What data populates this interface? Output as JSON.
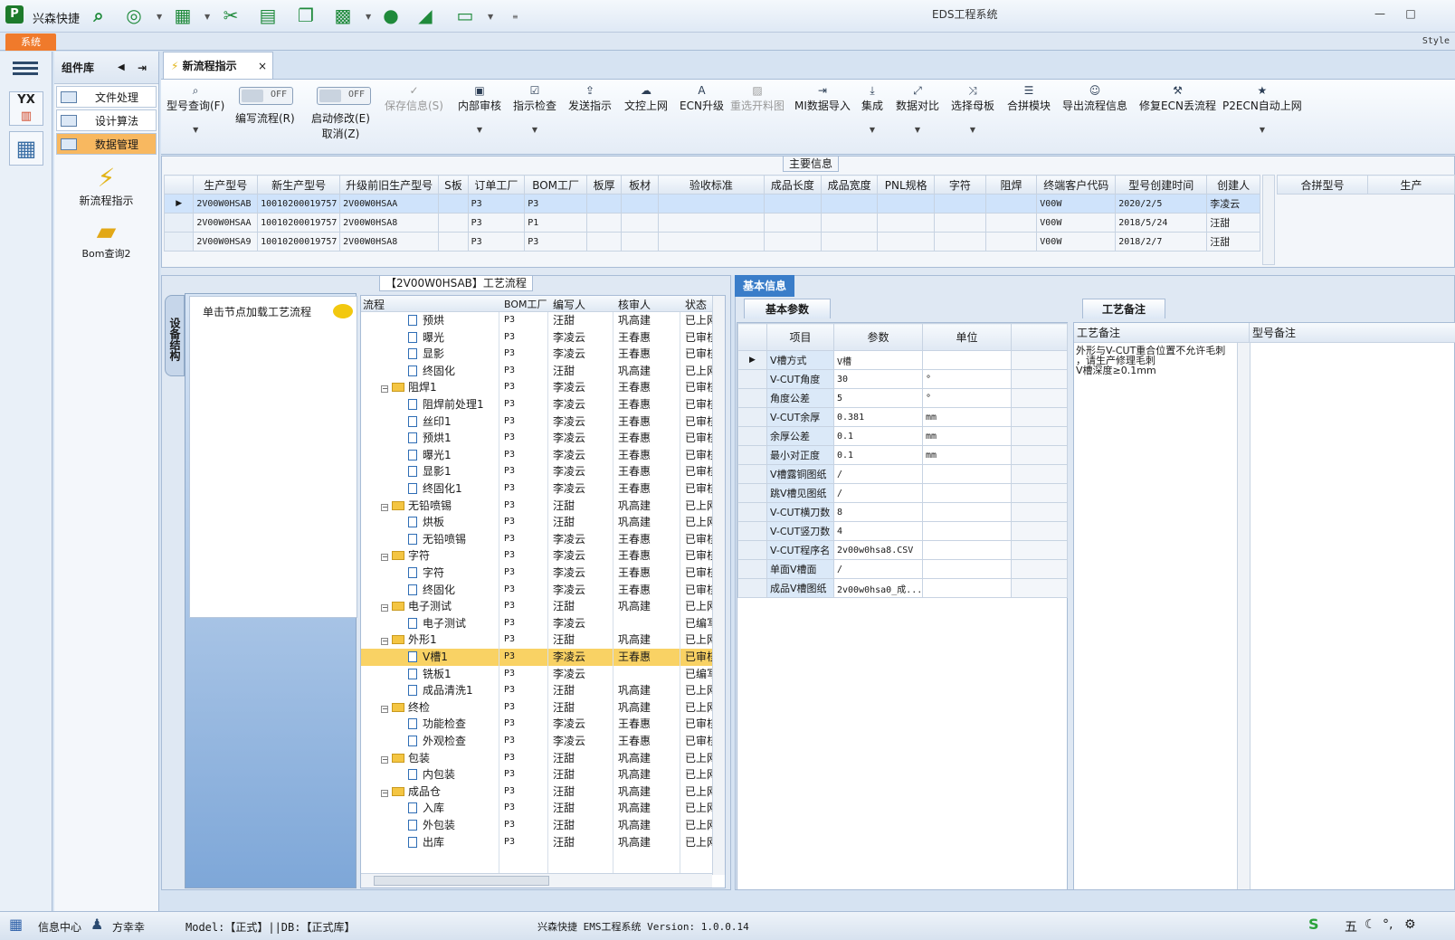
{
  "app": {
    "name": "兴森快捷",
    "window_title": "EDS工程系统",
    "system_tab": "系统",
    "style_label": "Style"
  },
  "quickbar_icons": [
    "search-icon",
    "lifebuoy-icon",
    "grid-icon",
    "scissors-icon",
    "film-icon",
    "copy-icon",
    "apps-icon",
    "user-icon",
    "chart-icon",
    "monitor-icon"
  ],
  "component_library": {
    "title": "组件库",
    "items": [
      {
        "label": "文件处理"
      },
      {
        "label": "设计算法"
      },
      {
        "label": "数据管理"
      }
    ],
    "launchers": [
      {
        "label": "新流程指示"
      },
      {
        "label": "Bom查询2"
      }
    ]
  },
  "main_tab": {
    "label": "新流程指示",
    "close": "×"
  },
  "toolbar": {
    "query": "型号查询(F)",
    "edit_flow": "编写流程(R)",
    "start_modify": "启动修改(E)",
    "cancel": "取消(Z)",
    "toggle_off": "OFF",
    "save": "保存信息(S)",
    "internal_review": "内部审核",
    "check": "指示检查",
    "send": "发送指示",
    "upload": "文控上网",
    "ecn_upgrade": "ECN升级",
    "reselect": "重选开料图",
    "mi_import": "MI数据导入",
    "integrate": "集成",
    "compare": "数据对比",
    "select_master": "选择母板",
    "merge": "合拼模块",
    "export": "导出流程信息",
    "fix_ecn": "修复ECN丢流程",
    "p2ecn": "P2ECN自动上网"
  },
  "main_info": {
    "title": "主要信息",
    "columns": [
      "生产型号",
      "新生产型号",
      "升级前旧生产型号",
      "S板",
      "订单工厂",
      "BOM工厂",
      "板厚",
      "板材",
      "验收标准",
      "成品长度",
      "成品宽度",
      "PNL规格",
      "字符",
      "阻焊",
      "终端客户代码",
      "型号创建时间",
      "创建人"
    ],
    "rows": [
      [
        "2V00W0HSAB",
        "10010200019757",
        "2V00W0HSAA",
        "",
        "P3",
        "P3",
        "",
        "",
        "",
        "",
        "",
        "",
        "",
        "",
        "V00W",
        "2020/2/5",
        "李凌云"
      ],
      [
        "2V00W0HSAA",
        "10010200019757",
        "2V00W0HSA8",
        "",
        "P3",
        "P1",
        "",
        "",
        "",
        "",
        "",
        "",
        "",
        "",
        "V00W",
        "2018/5/24",
        "汪甜"
      ],
      [
        "2V00W0HSA9",
        "10010200019757",
        "2V00W0HSA8",
        "",
        "P3",
        "P3",
        "",
        "",
        "",
        "",
        "",
        "",
        "",
        "",
        "V00W",
        "2018/2/7",
        "汪甜"
      ]
    ],
    "side_columns": [
      "合拼型号",
      "生产"
    ]
  },
  "process": {
    "title": "【2V00W0HSAB】工艺流程",
    "vertical_tab": "设备结构",
    "hint": "单击节点加载工艺流程",
    "columns": [
      "流程",
      "BOM工厂",
      "编写人",
      "核审人",
      "状态"
    ],
    "rows": [
      {
        "name": "预烘",
        "lvl": 2,
        "f": "P3",
        "w": "汪甜",
        "r": "巩高建",
        "s": "已上网"
      },
      {
        "name": "曝光",
        "lvl": 2,
        "f": "P3",
        "w": "李凌云",
        "r": "王春惠",
        "s": "已审核"
      },
      {
        "name": "显影",
        "lvl": 2,
        "f": "P3",
        "w": "李凌云",
        "r": "王春惠",
        "s": "已审核"
      },
      {
        "name": "终固化",
        "lvl": 2,
        "f": "P3",
        "w": "汪甜",
        "r": "巩高建",
        "s": "已上网"
      },
      {
        "name": "阻焊1",
        "lvl": 1,
        "f": "P3",
        "w": "李凌云",
        "r": "王春惠",
        "s": "已审核"
      },
      {
        "name": "阻焊前处理1",
        "lvl": 2,
        "f": "P3",
        "w": "李凌云",
        "r": "王春惠",
        "s": "已审核"
      },
      {
        "name": "丝印1",
        "lvl": 2,
        "f": "P3",
        "w": "李凌云",
        "r": "王春惠",
        "s": "已审核"
      },
      {
        "name": "预烘1",
        "lvl": 2,
        "f": "P3",
        "w": "李凌云",
        "r": "王春惠",
        "s": "已审核"
      },
      {
        "name": "曝光1",
        "lvl": 2,
        "f": "P3",
        "w": "李凌云",
        "r": "王春惠",
        "s": "已审核"
      },
      {
        "name": "显影1",
        "lvl": 2,
        "f": "P3",
        "w": "李凌云",
        "r": "王春惠",
        "s": "已审核"
      },
      {
        "name": "终固化1",
        "lvl": 2,
        "f": "P3",
        "w": "李凌云",
        "r": "王春惠",
        "s": "已审核"
      },
      {
        "name": "无铅喷锡",
        "lvl": 1,
        "f": "P3",
        "w": "汪甜",
        "r": "巩高建",
        "s": "已上网"
      },
      {
        "name": "烘板",
        "lvl": 2,
        "f": "P3",
        "w": "汪甜",
        "r": "巩高建",
        "s": "已上网"
      },
      {
        "name": "无铅喷锡",
        "lvl": 2,
        "f": "P3",
        "w": "李凌云",
        "r": "王春惠",
        "s": "已审核"
      },
      {
        "name": "字符",
        "lvl": 1,
        "f": "P3",
        "w": "李凌云",
        "r": "王春惠",
        "s": "已审核"
      },
      {
        "name": "字符",
        "lvl": 2,
        "f": "P3",
        "w": "李凌云",
        "r": "王春惠",
        "s": "已审核"
      },
      {
        "name": "终固化",
        "lvl": 2,
        "f": "P3",
        "w": "李凌云",
        "r": "王春惠",
        "s": "已审核"
      },
      {
        "name": "电子测试",
        "lvl": 1,
        "f": "P3",
        "w": "汪甜",
        "r": "巩高建",
        "s": "已上网"
      },
      {
        "name": "电子测试",
        "lvl": 2,
        "f": "P3",
        "w": "李凌云",
        "r": "",
        "s": "已编写"
      },
      {
        "name": "外形1",
        "lvl": 1,
        "f": "P3",
        "w": "汪甜",
        "r": "巩高建",
        "s": "已上网"
      },
      {
        "name": "V槽1",
        "lvl": 2,
        "f": "P3",
        "w": "李凌云",
        "r": "王春惠",
        "s": "已审核",
        "sel": true
      },
      {
        "name": "铣板1",
        "lvl": 2,
        "f": "P3",
        "w": "李凌云",
        "r": "",
        "s": "已编写"
      },
      {
        "name": "成品清洗1",
        "lvl": 2,
        "f": "P3",
        "w": "汪甜",
        "r": "巩高建",
        "s": "已上网"
      },
      {
        "name": "终检",
        "lvl": 1,
        "f": "P3",
        "w": "汪甜",
        "r": "巩高建",
        "s": "已上网"
      },
      {
        "name": "功能检查",
        "lvl": 2,
        "f": "P3",
        "w": "李凌云",
        "r": "王春惠",
        "s": "已审核"
      },
      {
        "name": "外观检查",
        "lvl": 2,
        "f": "P3",
        "w": "李凌云",
        "r": "王春惠",
        "s": "已审核"
      },
      {
        "name": "包装",
        "lvl": 1,
        "f": "P3",
        "w": "汪甜",
        "r": "巩高建",
        "s": "已上网"
      },
      {
        "name": "内包装",
        "lvl": 2,
        "f": "P3",
        "w": "汪甜",
        "r": "巩高建",
        "s": "已上网"
      },
      {
        "name": "成品仓",
        "lvl": 1,
        "f": "P3",
        "w": "汪甜",
        "r": "巩高建",
        "s": "已上网"
      },
      {
        "name": "入库",
        "lvl": 2,
        "f": "P3",
        "w": "汪甜",
        "r": "巩高建",
        "s": "已上网"
      },
      {
        "name": "外包装",
        "lvl": 2,
        "f": "P3",
        "w": "汪甜",
        "r": "巩高建",
        "s": "已上网"
      },
      {
        "name": "出库",
        "lvl": 2,
        "f": "P3",
        "w": "汪甜",
        "r": "巩高建",
        "s": "已上网"
      }
    ]
  },
  "basic": {
    "tab": "基本信息",
    "param_tab": "基本参数",
    "columns": [
      "项目",
      "参数",
      "单位"
    ],
    "rows": [
      [
        "V槽方式",
        "V槽",
        ""
      ],
      [
        "V-CUT角度",
        "30",
        "°"
      ],
      [
        "角度公差",
        "5",
        "°"
      ],
      [
        "V-CUT余厚",
        "0.381",
        "mm"
      ],
      [
        "余厚公差",
        "0.1",
        "mm"
      ],
      [
        "最小对正度",
        "0.1",
        "mm"
      ],
      [
        "V槽露铜图纸",
        "/",
        ""
      ],
      [
        "跳V槽见图纸",
        "/",
        ""
      ],
      [
        "V-CUT横刀数",
        "8",
        ""
      ],
      [
        "V-CUT竖刀数",
        "4",
        ""
      ],
      [
        "V-CUT程序名",
        "2v00w0hsa8.CSV",
        ""
      ],
      [
        "单面V槽面",
        "/",
        ""
      ],
      [
        "成品V槽图纸",
        "2v00w0hsa0_成...",
        ""
      ]
    ]
  },
  "notes": {
    "tab": "工艺备注",
    "columns": [
      "工艺备注",
      "型号备注"
    ],
    "text": [
      "外形与V-CUT重合位置不允许毛刺",
      "，请生产修理毛刺",
      "V槽深度≥0.1mm"
    ]
  },
  "status": {
    "info_center": "信息中心",
    "user": "方幸幸",
    "model": "Model:【正式】||DB:【正式库】",
    "version": "兴森快捷 EMS工程系统 Version: 1.0.0.14",
    "ime": "五"
  }
}
